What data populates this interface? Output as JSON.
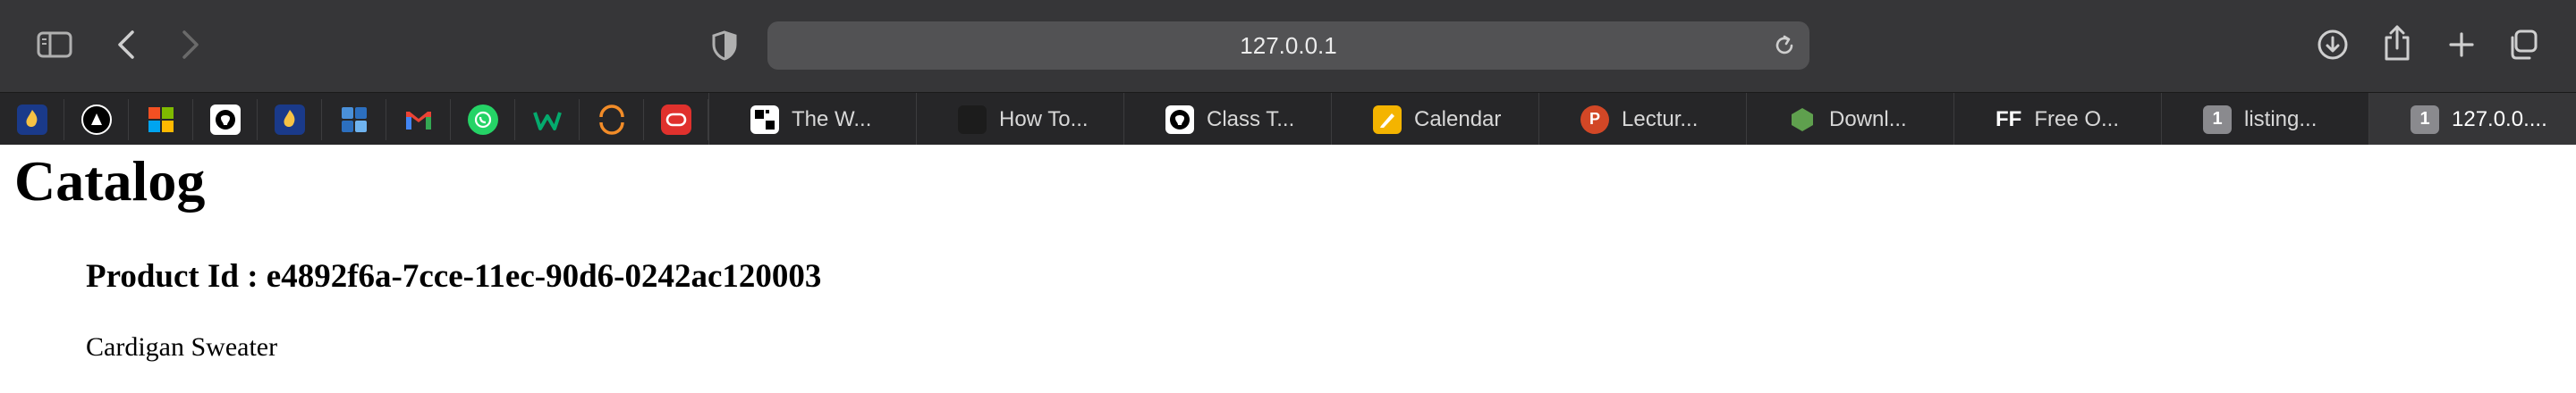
{
  "browser": {
    "url": "127.0.0.1",
    "tabs": [
      {
        "label": "The W...",
        "icon": "w-logo-icon",
        "active": false
      },
      {
        "label": "How To...",
        "icon": "dark-site-icon",
        "active": false
      },
      {
        "label": "Class T...",
        "icon": "github-icon",
        "active": false
      },
      {
        "label": "Calendar",
        "icon": "calendar-pencil-icon",
        "active": false
      },
      {
        "label": "Lectur...",
        "icon": "powerpoint-icon",
        "active": false
      },
      {
        "label": "Downl...",
        "icon": "hexagon-icon",
        "active": false
      },
      {
        "label": "Free O...",
        "icon": "ff-icon",
        "active": false
      },
      {
        "label": "listing...",
        "icon": "tab-group-icon",
        "active": false
      },
      {
        "label": "127.0.0....",
        "icon": "tab-group-icon",
        "active": true
      }
    ],
    "tab_badges": {
      "ff": "FF",
      "group": "1",
      "group_active": "1"
    },
    "pinned_icons": [
      "fireship-icon",
      "wizard-icon",
      "microsoft-icon",
      "github-icon",
      "fireship-icon",
      "blocks-icon",
      "gmail-icon",
      "whatsapp-icon",
      "w3schools-icon",
      "ring-icon",
      "oracle-icon"
    ]
  },
  "page": {
    "title": "Catalog",
    "product_heading": "Product Id : e4892f6a-7cce-11ec-90d6-0242ac120003",
    "product_name": "Cardigan Sweater"
  },
  "colors": {
    "toolbar": "#363638",
    "tabstrip": "#262628",
    "urlbar": "#525254",
    "page_bg": "#ffffff"
  }
}
